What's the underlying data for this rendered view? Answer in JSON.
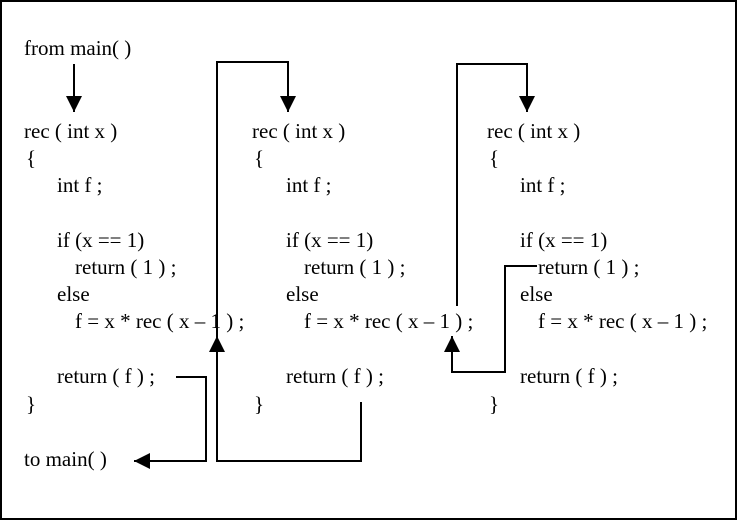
{
  "from_main": "from main( )",
  "to_main": "to main( )",
  "frames": [
    {
      "header": "rec ( int x )",
      "open_brace": "{",
      "decl": "int f ;",
      "if_line": "if (x == 1)",
      "return_one": "return ( 1 ) ;",
      "else_line": "else",
      "recursive_line": "f = x * rec ( x – 1 ) ;",
      "return_f": "return ( f ) ;",
      "close_brace": "}"
    },
    {
      "header": "rec ( int x )",
      "open_brace": "{",
      "decl": "int f ;",
      "if_line": "if (x == 1)",
      "return_one": "return ( 1 ) ;",
      "else_line": "else",
      "recursive_line": "f = x * rec ( x – 1 ) ;",
      "return_f": "return ( f ) ;",
      "close_brace": "}"
    },
    {
      "header": "rec ( int x )",
      "open_brace": "{",
      "decl": "int f ;",
      "if_line": "if (x == 1)",
      "return_one": "return ( 1 ) ;",
      "else_line": "else",
      "recursive_line": "f = x * rec ( x – 1 ) ;",
      "return_f": "return ( f ) ;",
      "close_brace": "}"
    }
  ]
}
